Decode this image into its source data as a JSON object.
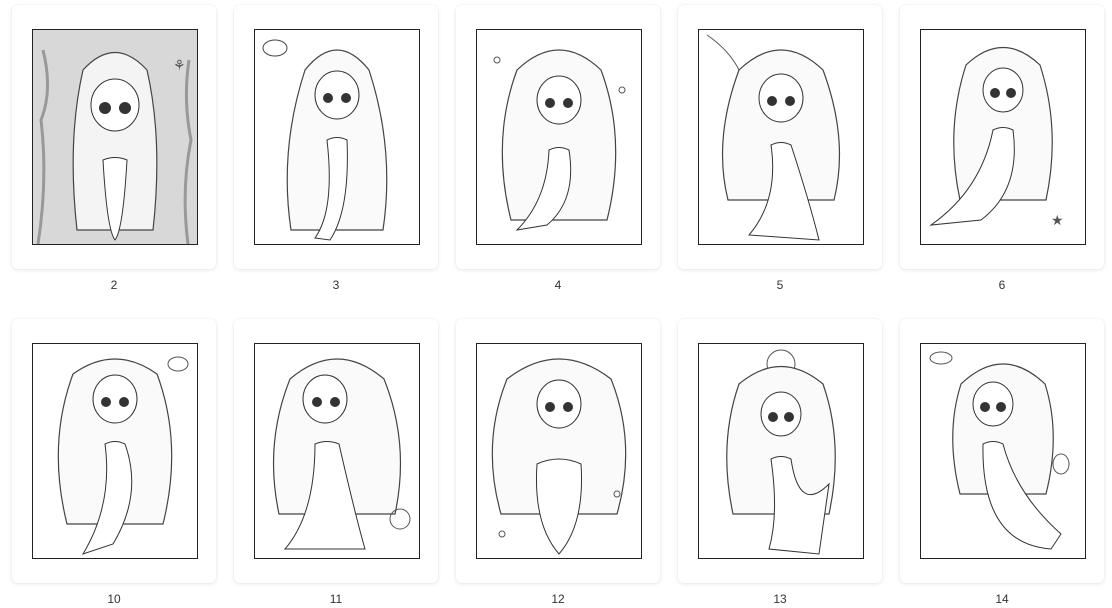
{
  "thumbnails": [
    {
      "page_number": "2",
      "image": "mermaid-coloring-page"
    },
    {
      "page_number": "3",
      "image": "mermaid-coloring-page"
    },
    {
      "page_number": "4",
      "image": "mermaid-coloring-page"
    },
    {
      "page_number": "5",
      "image": "mermaid-coloring-page"
    },
    {
      "page_number": "6",
      "image": "mermaid-coloring-page"
    },
    {
      "page_number": "10",
      "image": "mermaid-coloring-page"
    },
    {
      "page_number": "11",
      "image": "mermaid-coloring-page"
    },
    {
      "page_number": "12",
      "image": "mermaid-coloring-page"
    },
    {
      "page_number": "13",
      "image": "mermaid-coloring-page"
    },
    {
      "page_number": "14",
      "image": "mermaid-coloring-page"
    }
  ]
}
